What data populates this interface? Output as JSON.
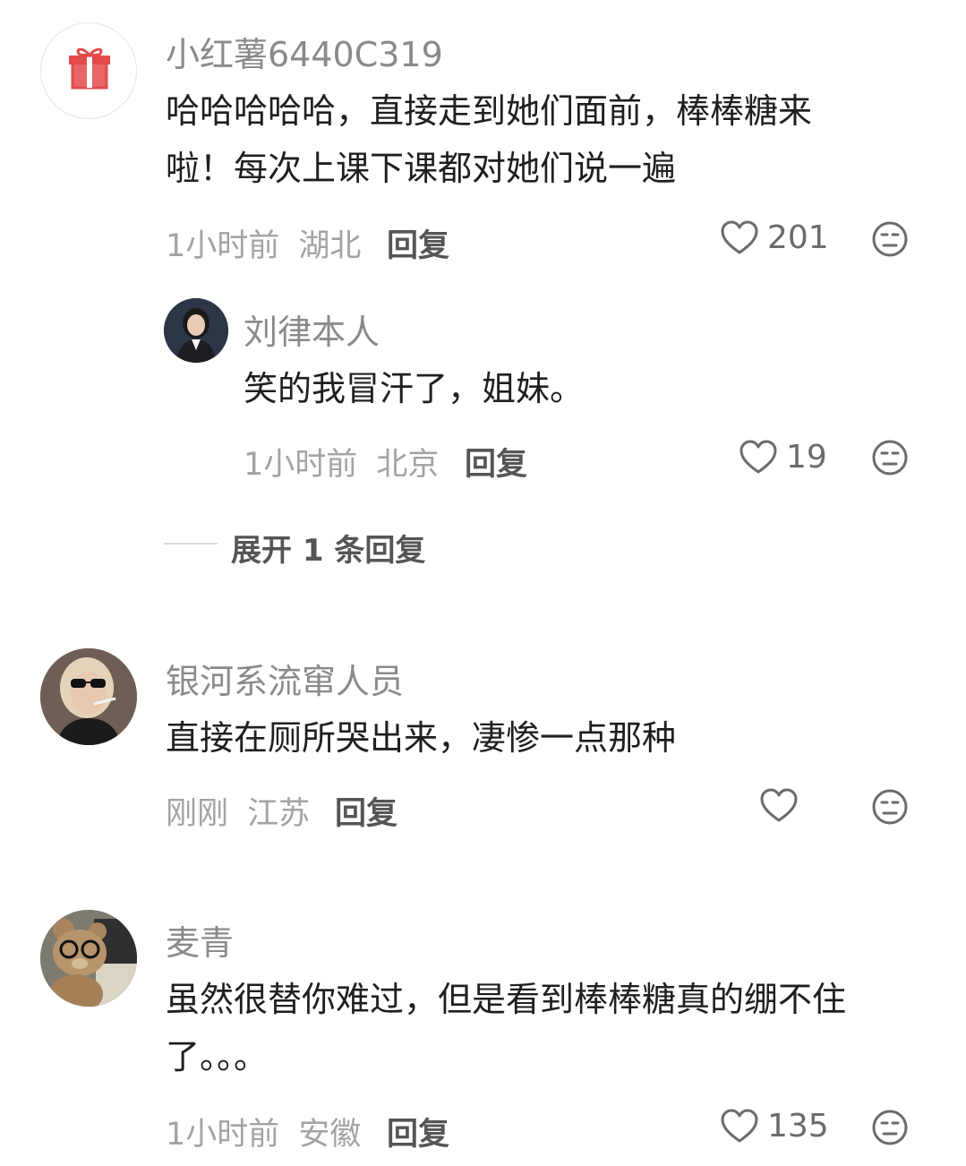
{
  "comments": [
    {
      "username": "小红薯6440C319",
      "text_lines": [
        "哈哈哈哈哈，直接走到她们面前，棒棒糖来",
        "啦！每次上课下课都对她们说一遍"
      ],
      "time": "1小时前",
      "location": "湖北",
      "reply_label": "回复",
      "likes": "201",
      "avatar_icon": "gift-icon",
      "reply": {
        "username": "刘律本人",
        "text": "笑的我冒汗了，姐妹。",
        "time": "1小时前",
        "location": "北京",
        "reply_label": "回复",
        "likes": "19"
      },
      "expand_label": "展开 1 条回复"
    },
    {
      "username": "银河系流窜人员",
      "text_lines": [
        "直接在厕所哭出来，凄惨一点那种"
      ],
      "time": "刚刚",
      "location": "江苏",
      "reply_label": "回复",
      "likes": ""
    },
    {
      "username": "麦青",
      "text_lines": [
        "虽然很替你难过，但是看到棒棒糖真的绷不住",
        "了。。。"
      ],
      "time": "1小时前",
      "location": "安徽",
      "reply_label": "回复",
      "likes": "135"
    }
  ],
  "colors": {
    "gift_red": "#e34b4b",
    "text_primary": "#1f1f1f",
    "text_secondary": "#8a8a8a",
    "icon_gray": "#6b6b6b"
  }
}
